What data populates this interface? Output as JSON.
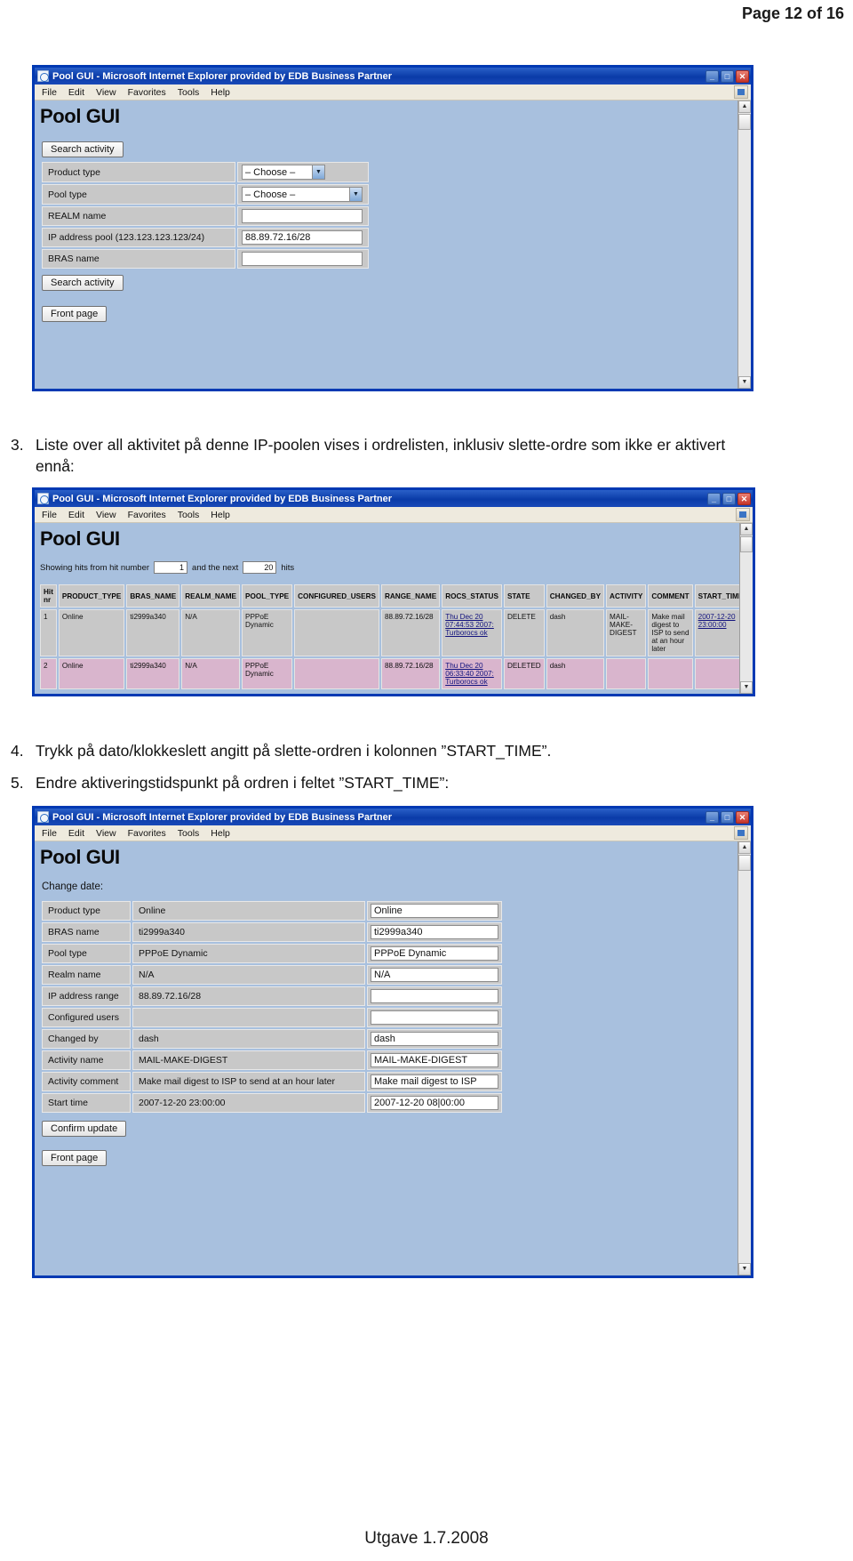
{
  "page": {
    "header": "Page 12 of 16",
    "footer": "Utgave 1.7.2008"
  },
  "steps": [
    {
      "num": "3.",
      "text": "Liste over all aktivitet på denne IP-poolen vises i ordrelisten, inklusiv slette-ordre som ikke er aktivert ennå:"
    },
    {
      "num": "4.",
      "text": "Trykk på dato/klokkeslett angitt på slette-ordren i kolonnen ”START_TIME”."
    },
    {
      "num": "5.",
      "text": "Endre aktiveringstidspunkt på ordren i feltet ”START_TIME”:"
    }
  ],
  "window_common": {
    "title": "Pool GUI - Microsoft Internet Explorer provided by EDB Business Partner",
    "menu": [
      "File",
      "Edit",
      "View",
      "Favorites",
      "Tools",
      "Help"
    ],
    "brand": "Pool GUI",
    "min_label": "_",
    "max_label": "□",
    "close_label": "✕"
  },
  "window1": {
    "search_button_top": "Search activity",
    "search_button_bottom": "Search activity",
    "front_page_button": "Front page",
    "fields": [
      {
        "label": "Product type",
        "control": "select",
        "value": "– Choose –"
      },
      {
        "label": "Pool type",
        "control": "select",
        "value": "– Choose –"
      },
      {
        "label": "REALM name",
        "control": "input",
        "value": ""
      },
      {
        "label": "IP address pool (123.123.123.123/24)",
        "control": "input",
        "value": "88.89.72.16/28"
      },
      {
        "label": "BRAS name",
        "control": "input",
        "value": ""
      }
    ]
  },
  "window2": {
    "showing_prefix": "Showing hits from hit number",
    "showing_from": "1",
    "showing_middle": "and the next",
    "showing_count": "20",
    "showing_suffix": "hits",
    "columns": [
      "Hit nr",
      "PRODUCT_TYPE",
      "BRAS_NAME",
      "REALM_NAME",
      "POOL_TYPE",
      "CONFIGURED_USERS",
      "RANGE_NAME",
      "ROCS_STATUS",
      "STATE",
      "CHANGED_BY",
      "ACTIVITY",
      "COMMENT",
      "START_TIME"
    ],
    "rows": [
      {
        "hit": "1",
        "product_type": "Online",
        "bras_name": "ti2999a340",
        "realm_name": "N/A",
        "pool_type": "PPPoE Dynamic",
        "configured_users": "",
        "range_name": "88.89.72.16/28",
        "rocs_status": "Thu Dec 20 07:44:53 2007: Turborocs ok",
        "state": "DELETE",
        "changed_by": "dash",
        "activity": "MAIL-MAKE-DIGEST",
        "comment": "Make mail digest to ISP to send at an hour later",
        "start_time": "2007-12-20 23:00:00"
      },
      {
        "hit": "2",
        "product_type": "Online",
        "bras_name": "ti2999a340",
        "realm_name": "N/A",
        "pool_type": "PPPoE Dynamic",
        "configured_users": "",
        "range_name": "88.89.72.16/28",
        "rocs_status": "Thu Dec 20 06:33:40 2007: Turborocs ok",
        "state": "DELETED",
        "changed_by": "dash",
        "activity": "",
        "comment": "",
        "start_time": ""
      }
    ]
  },
  "window3": {
    "section_title": "Change date:",
    "confirm_button": "Confirm update",
    "front_page_button": "Front page",
    "rows": [
      {
        "label": "Product type",
        "value": "Online",
        "field": "Online"
      },
      {
        "label": "BRAS name",
        "value": "ti2999a340",
        "field": "ti2999a340"
      },
      {
        "label": "Pool type",
        "value": "PPPoE Dynamic",
        "field": "PPPoE Dynamic"
      },
      {
        "label": "Realm name",
        "value": "N/A",
        "field": "N/A"
      },
      {
        "label": "IP address range",
        "value": "88.89.72.16/28",
        "field": ""
      },
      {
        "label": "Configured users",
        "value": "",
        "field": ""
      },
      {
        "label": "Changed by",
        "value": "dash",
        "field": "dash"
      },
      {
        "label": "Activity name",
        "value": "MAIL-MAKE-DIGEST",
        "field": "MAIL-MAKE-DIGEST"
      },
      {
        "label": "Activity comment",
        "value": "Make mail digest to ISP to send at an hour later",
        "field": "Make mail digest to ISP"
      },
      {
        "label": "Start time",
        "value": "2007-12-20 23:00:00",
        "field": "2007-12-20 08|00:00"
      }
    ]
  },
  "colors": {
    "title_bar": "#0a3ba8",
    "window_border": "#0039b3",
    "page_bg": "#a8c0de",
    "cell_grey": "#c8c8c8",
    "row_highlight": "#d9b5cd",
    "link": "#12127e"
  }
}
